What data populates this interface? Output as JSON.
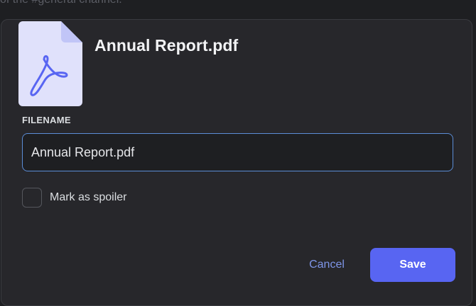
{
  "background": {
    "text": "of the #general channel."
  },
  "dialog": {
    "icon": "pdf-file-icon",
    "title": "Annual Report.pdf",
    "field_label": "FILENAME",
    "filename_value": "Annual Report.pdf",
    "spoiler_label": "Mark as spoiler",
    "spoiler_checked": false,
    "cancel_label": "Cancel",
    "save_label": "Save"
  },
  "colors": {
    "accent": "#5865f2",
    "link": "#7e95e8",
    "file_icon_bg": "#e0e1fb",
    "file_icon_symbol": "#5865f2",
    "input_border_focus": "#5b8dd6"
  }
}
